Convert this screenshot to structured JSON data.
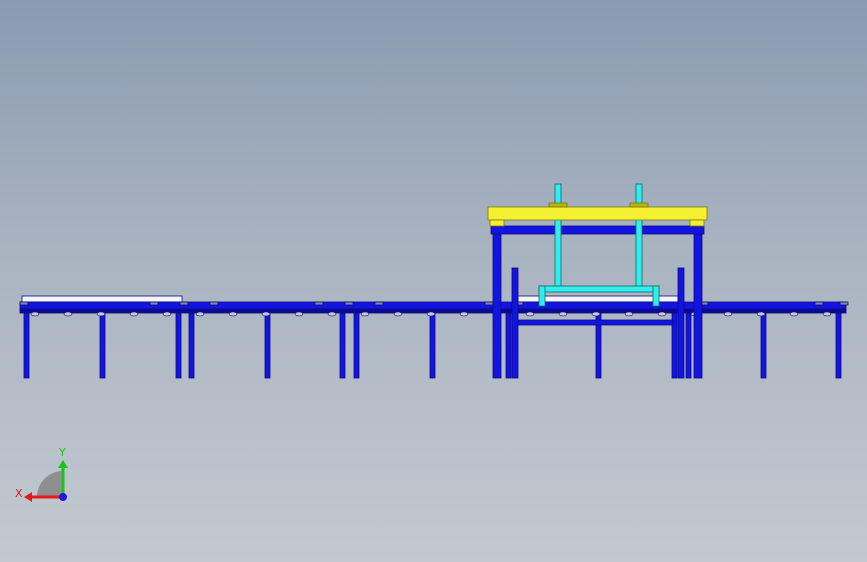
{
  "scene": {
    "view": "front",
    "colors": {
      "frame": "#1414e0",
      "frame_dark": "#0a0a90",
      "gantry_beam": "#f5f032",
      "lift_arm": "#33ecec",
      "tray": "#f4f4f4",
      "roller": "#c8c8d8"
    },
    "conveyor_sections": 4,
    "gantry": true
  },
  "triad": {
    "x_label": "X",
    "y_label": "Y",
    "x_color": "#e21a1a",
    "y_color": "#19c41e",
    "z_color": "#1a1ae0"
  }
}
